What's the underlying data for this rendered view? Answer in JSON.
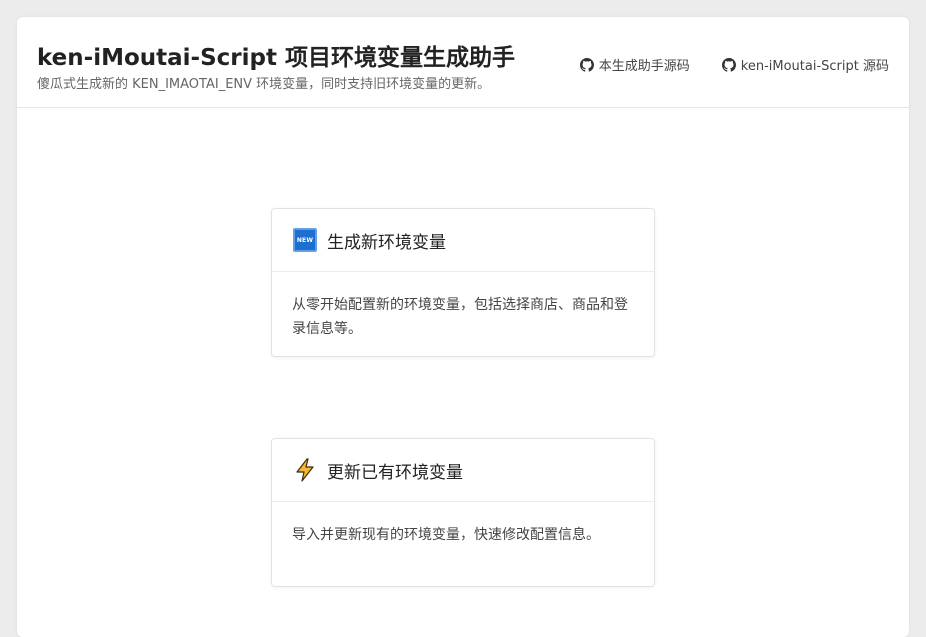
{
  "header": {
    "title": "ken-iMoutai-Script 项目环境变量生成助手",
    "subtitle": "傻瓜式生成新的 KEN_IMAOTAI_ENV 环境变量，同时支持旧环境变量的更新。",
    "links": [
      {
        "label": "本生成助手源码",
        "icon": "github-icon"
      },
      {
        "label": "ken-iMoutai-Script 源码",
        "icon": "github-icon"
      }
    ]
  },
  "cards": [
    {
      "icon": "new-badge-icon",
      "icon_text": "NEW",
      "title": "生成新环境变量",
      "description": "从零开始配置新的环境变量，包括选择商店、商品和登录信息等。"
    },
    {
      "icon": "lightning-icon",
      "title": "更新已有环境变量",
      "description": "导入并更新现有的环境变量，快速修改配置信息。"
    }
  ],
  "colors": {
    "new_badge": "#1e6fd0",
    "lightning": "#f5b82e"
  }
}
